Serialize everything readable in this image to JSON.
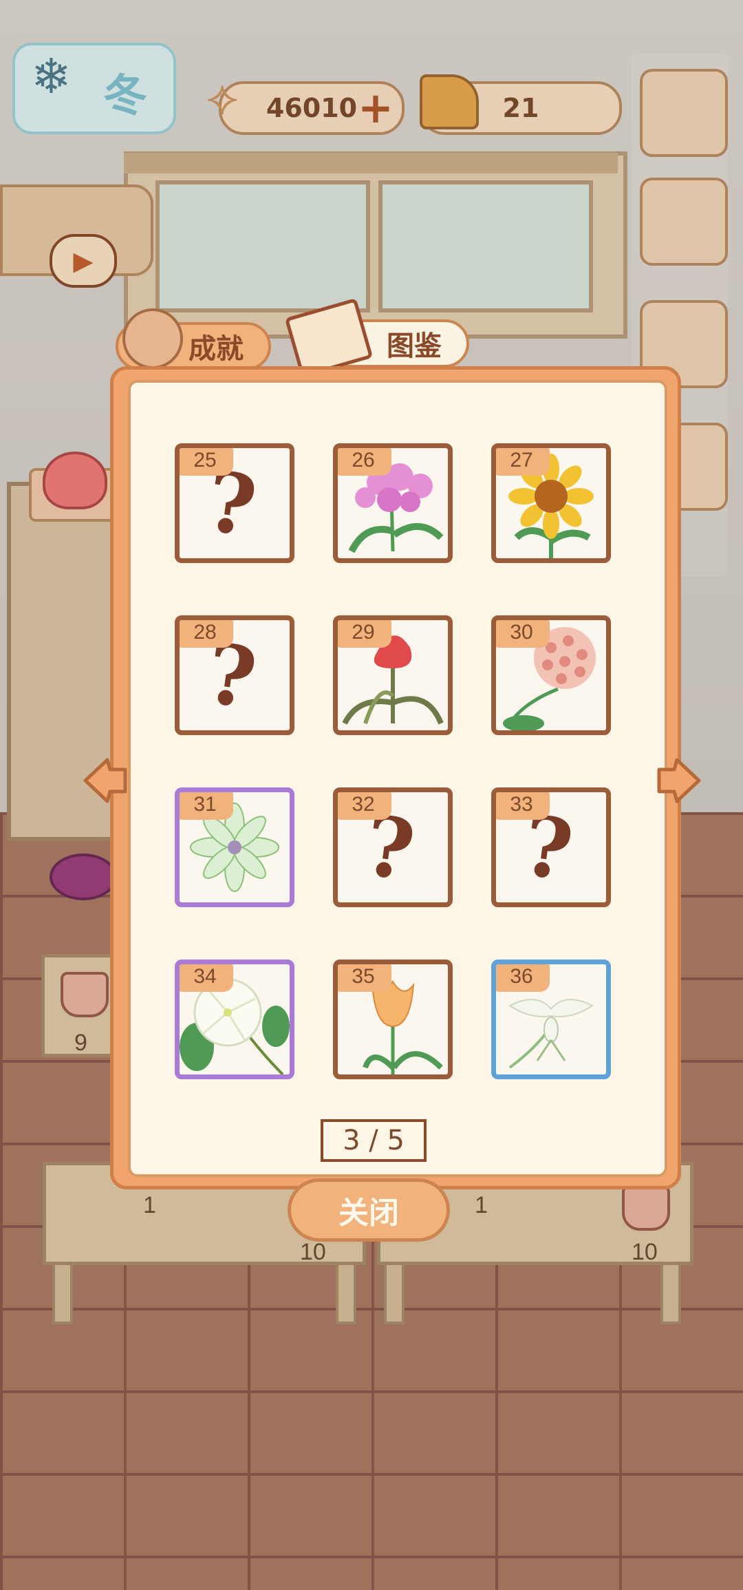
{
  "hud": {
    "season": "冬",
    "coins": "46010",
    "cheese": "21"
  },
  "tabs": {
    "achievements": "成就",
    "collection": "图鉴"
  },
  "collection": {
    "cells": [
      {
        "number": "25",
        "unlocked": false,
        "icon": "question-mark-icon"
      },
      {
        "number": "26",
        "unlocked": true,
        "icon": "pink-phlox-flower-icon"
      },
      {
        "number": "27",
        "unlocked": true,
        "icon": "sunflower-icon"
      },
      {
        "number": "28",
        "unlocked": false,
        "icon": "question-mark-icon"
      },
      {
        "number": "29",
        "unlocked": true,
        "icon": "red-celosia-flower-icon"
      },
      {
        "number": "30",
        "unlocked": true,
        "icon": "hoya-flower-icon"
      },
      {
        "number": "31",
        "unlocked": true,
        "icon": "green-chrysanthemum-icon",
        "rarity": "purple"
      },
      {
        "number": "32",
        "unlocked": false,
        "icon": "question-mark-icon"
      },
      {
        "number": "33",
        "unlocked": false,
        "icon": "question-mark-icon"
      },
      {
        "number": "34",
        "unlocked": true,
        "icon": "white-petunia-icon",
        "rarity": "purple"
      },
      {
        "number": "35",
        "unlocked": true,
        "icon": "orange-tulip-icon"
      },
      {
        "number": "36",
        "unlocked": true,
        "icon": "white-egret-orchid-icon",
        "rarity": "blue"
      }
    ],
    "pager": "3 / 5",
    "close_label": "关闭"
  },
  "floor": {
    "left_table_count": "9",
    "table1_count": "1",
    "table1_sub": "10",
    "table2_count": "1",
    "table2_sub": "10"
  },
  "colors": {
    "panel_orange": "#f0a56c",
    "panel_cream": "#fdf6e6",
    "frame_brown": "#9b5c3a",
    "rarity_purple": "#a97bd6",
    "rarity_blue": "#5ea2d8"
  }
}
